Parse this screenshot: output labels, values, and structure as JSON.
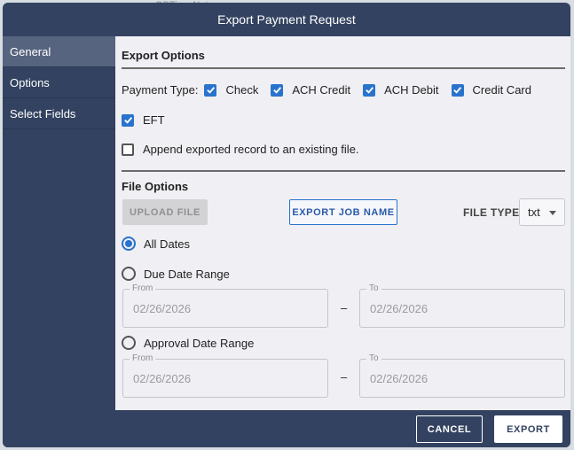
{
  "background": {
    "text": "OPTionsNot"
  },
  "dialog": {
    "title": "Export Payment Request"
  },
  "sidebar": {
    "items": [
      {
        "label": "General",
        "active": true
      },
      {
        "label": "Options",
        "active": false
      },
      {
        "label": "Select Fields",
        "active": false
      }
    ]
  },
  "export_options": {
    "title": "Export Options",
    "payment_type_label": "Payment Type:",
    "payment_types": [
      {
        "label": "Check",
        "checked": true
      },
      {
        "label": "ACH Credit",
        "checked": true
      },
      {
        "label": "ACH Debit",
        "checked": true
      },
      {
        "label": "Credit Card",
        "checked": true
      },
      {
        "label": "EFT",
        "checked": true
      }
    ],
    "append_label": "Append exported record to an existing file.",
    "append_checked": false
  },
  "file_options": {
    "title": "File Options",
    "upload_label": "UPLOAD FILE",
    "job_name_label": "EXPORT JOB NAME",
    "file_type_label": "FILE TYPE",
    "file_type_value": "txt",
    "dates": {
      "all_label": "All Dates",
      "due_label": "Due Date Range",
      "approval_label": "Approval Date Range",
      "selected": "all",
      "from_label": "From",
      "to_label": "To",
      "dash": "–",
      "due_from": "02/26/2026",
      "due_to": "02/26/2026",
      "approval_from": "02/26/2026",
      "approval_to": "02/26/2026"
    }
  },
  "footer": {
    "cancel_label": "CANCEL",
    "export_label": "EXPORT"
  },
  "colors": {
    "header": "#334260",
    "accent": "#2a73cc",
    "content_bg": "#efeff4"
  }
}
